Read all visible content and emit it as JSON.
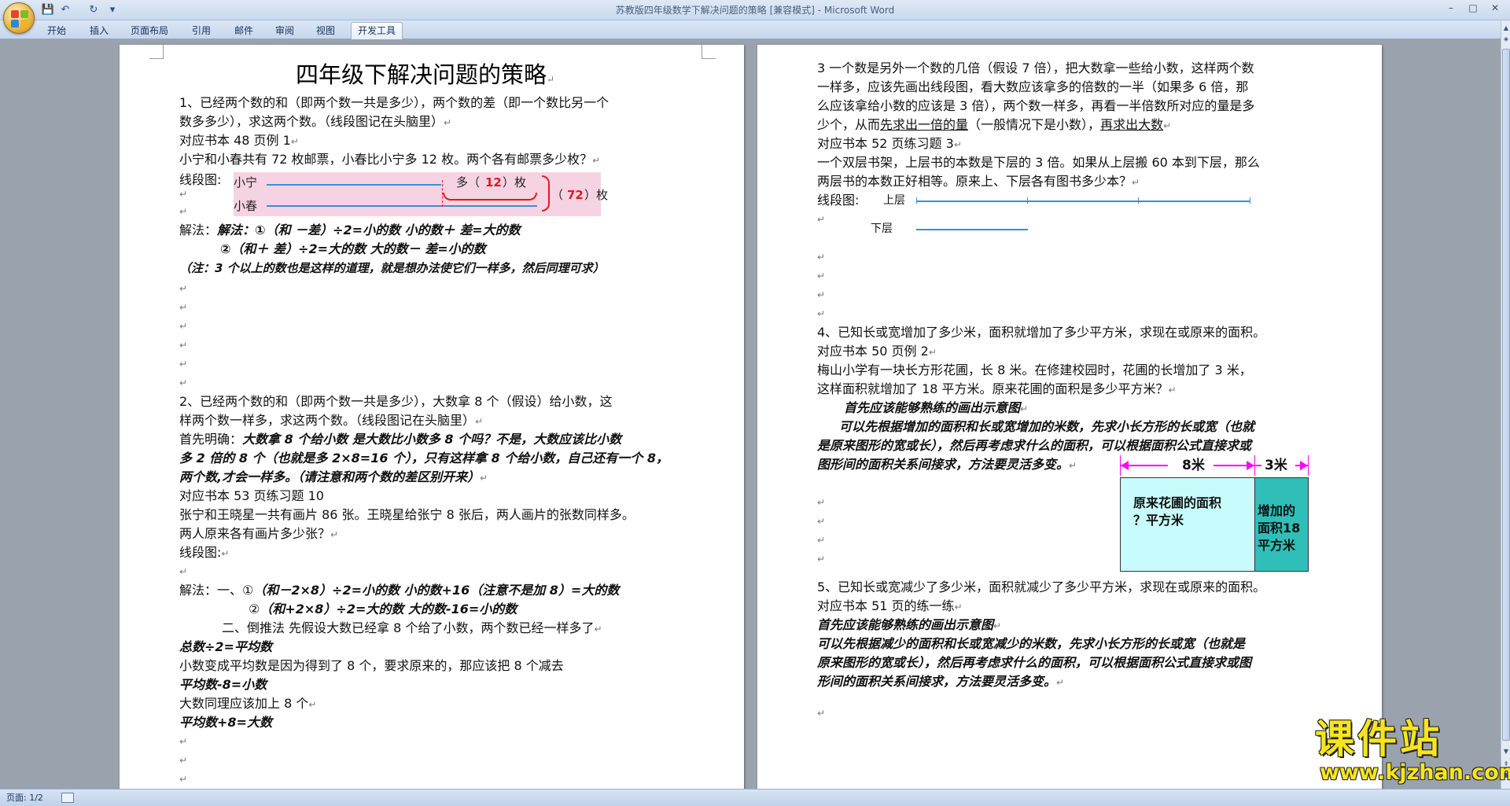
{
  "window": {
    "title": "苏教版四年级数学下解决问题的策略 [兼容模式] - Microsoft Word",
    "minimize": "–",
    "maximize": "□",
    "close": "✕"
  },
  "quick_access": {
    "save": "💾",
    "undo": "↶",
    "redo": "↻",
    "more": "▾"
  },
  "ribbon": {
    "tabs": [
      {
        "label": "开始"
      },
      {
        "label": "插入"
      },
      {
        "label": "页面布局"
      },
      {
        "label": "引用"
      },
      {
        "label": "邮件"
      },
      {
        "label": "审阅"
      },
      {
        "label": "视图"
      },
      {
        "label": "开发工具"
      }
    ],
    "active_tab": "开发工具"
  },
  "mark": "↵",
  "page1": {
    "title": "四年级下解决问题的策略",
    "lines": [
      "1、已经两个数的和（即两个数一共是多少），两个数的差（即一个数比另一个",
      "数多多少），求这两个数。（线段图记在头脑里）",
      "对应书本 48 页例 1",
      "小宁和小春共有 72 枚邮票，小春比小宁多 12 枚。两个各有邮票多少枚？",
      "线段图:",
      "解法：①（和 －差）÷2=小的数   小的数＋ 差=大的数",
      "②（和＋ 差）÷2=大的数   大的数－ 差=小的数",
      "（注：3 个以上的数也是这样的道理，就是想办法使它们一样多，然后同理可求）",
      "2、已经两个数的和（即两个数一共是多少），大数拿 8 个（假设）给小数，这",
      "样两个数一样多，求这两个数。（线段图记在头脑里）",
      "首先明确：",
      "大数拿 8 个给小数 是大数比小数多 8 个吗？不是，大数应该比小数",
      "多 2 倍的 8 个（也就是多 2×8=16 个），只有这样拿 8 个给小数，自己还有一个 8，",
      "两个数,才会一样多。（请注意和两个数的差区别开来）",
      "对应书本 53 页练习题 10",
      "张宁和王晓星一共有画片 86 张。王晓星给张宁 8 张后，两人画片的张数同样多。",
      "两人原来各有画片多少张？",
      "线段图:",
      "解法：一、①",
      "（和－2×8）÷2=小的数   小的数+16（注意不是加 8）=大的数",
      "②",
      "（和+2×8）÷2=大的数   大的数-16=小的数",
      "二、倒推法 先假设大数已经拿 8 个给了小数，两个数已经一样多了",
      "总数÷2=平均数",
      "小数变成平均数是因为得到了 8 个，要求原来的，那应该把 8 个减去",
      "平均数-8=小数",
      "大数同理应该加上 8 个",
      "平均数+8=大数"
    ],
    "diagram": {
      "xiaoning": "小宁",
      "xiaochun": "小春",
      "duo": "多（",
      "diff": "12",
      "mei_close": "）枚",
      "total_open": "（",
      "total": "72",
      "total_close": "）枚"
    }
  },
  "page2": {
    "lines": [
      "3 一个数是另外一个数的几倍（假设 7 倍），把大数拿一些给小数，这样两个数",
      "一样多，应该先画出线段图，看大数应该拿",
      "多的倍数的一半",
      "（如果多 6 倍，那",
      "么应该拿给小数的应该是 3 倍），两个数一样多，再看",
      "一半倍数所对应的量是多",
      "少个",
      "，从而",
      "先求出一倍的量",
      "（一般情况下是小数），",
      "再求出大数",
      "对应书本 52 页练习题 3",
      "一个双层书架，上层书的本数是下层的 3 倍。如果从上层搬 60 本到下层，那么",
      "两层书的本数正好相等。原来上、下层各有图书多少本？",
      "线段图:",
      "上层",
      "下层",
      "4、已知长或宽增加了多少米，面积就增加了多少平方米，求现在或原来的面积。",
      "对应书本 50 页例 2",
      "梅山小学有一块长方形花圃，长 8 米。在修建校园时，花圃的长增加了 3 米，",
      "这样面积就增加了 18 平方米。原来花圃的面积是多少平方米？",
      "首先应该能够熟练的画出示意图",
      "可以先根据增加的面积和长或宽增加的米数，先求小长方形的长或宽（也就",
      "是原来图形的宽或长），然后再考虑求什么的面积，可以根据面积公式直接求或",
      "图形间的面积关系间接求，方法要灵活多变。",
      "5、已知长或宽减少了多少米，面积就减少了多少平方米，求现在或原来的面积。",
      "对应书本 51 页的练一练",
      "首先应该能够熟练的画出示意图",
      "可以先根据减少的面积和长或宽减少的米数，先求小长方形的长或宽（也就是",
      "原来图形的宽或长），然后再考虑求什么的面积，可以根据面积公式直接求或图",
      "形间的面积关系间接求，方法要灵活多变。"
    ],
    "rect_diagram": {
      "len1": "8米",
      "len2": "3米",
      "area1": "原来花圃的面积？平方米",
      "area1_a": "原来花圃的面积",
      "area1_b": "？平方米",
      "area2_a": "增加的",
      "area2_b": "面积18",
      "area2_c": "平方米",
      "colors": {
        "area1": "#c8fbfb",
        "area2": "#2fbfb8",
        "arrow": "#ff00ff"
      }
    }
  },
  "statusbar": {
    "page": "页面: 1/2"
  },
  "watermark": {
    "brand": "课件站",
    "url": "www.kjzhan.com"
  },
  "colors": {
    "workspace": "#9aa3ad",
    "diagram_bg": "#f6d3e2",
    "segment": "#3a8fd6",
    "highlight": "#e0191f"
  }
}
